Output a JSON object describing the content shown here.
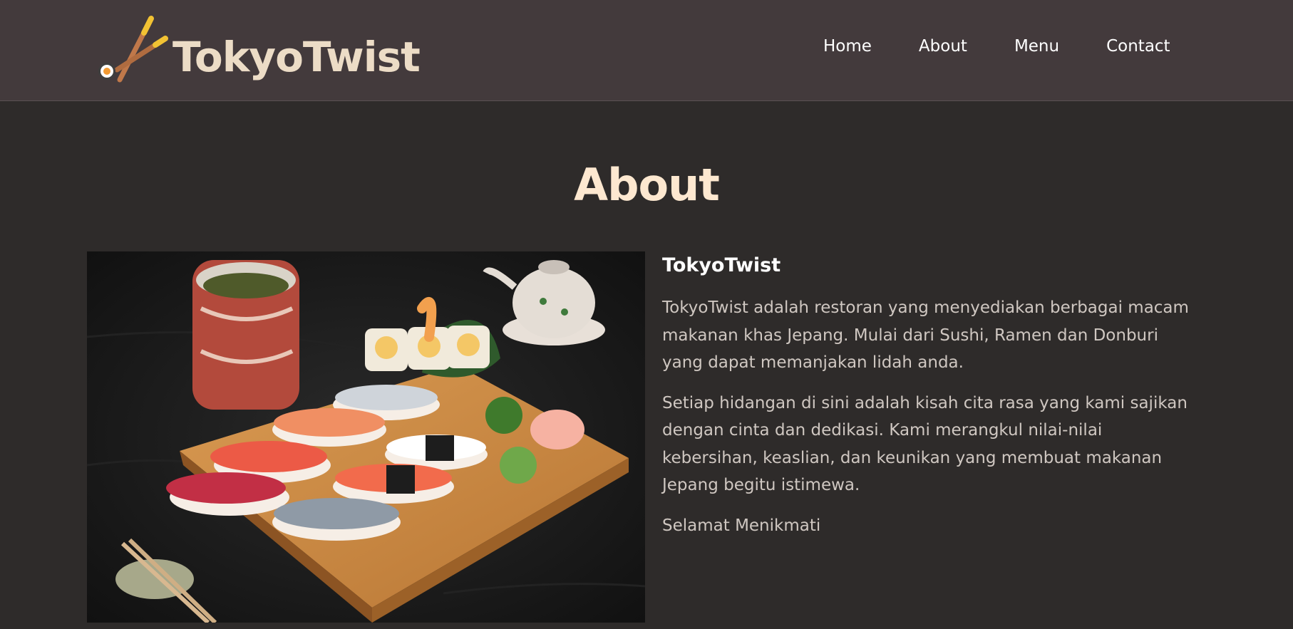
{
  "brand": {
    "name": "TokyoTwist",
    "logo_icon": "chopsticks-sushi-icon"
  },
  "nav": {
    "items": [
      {
        "label": "Home"
      },
      {
        "label": "About"
      },
      {
        "label": "Menu"
      },
      {
        "label": "Contact"
      }
    ]
  },
  "about": {
    "title": "About",
    "image": "sushi-platter-photo",
    "heading": "TokyoTwist",
    "paragraphs": [
      "TokyoTwist adalah restoran yang menyediakan berbagai macam makanan khas Jepang. Mulai dari Sushi, Ramen dan Donburi yang dapat memanjakan lidah anda.",
      "Setiap hidangan di sini adalah kisah cita rasa yang kami sajikan dengan cinta dan dedikasi. Kami merangkul nilai-nilai kebersihan, keaslian, dan keunikan yang membuat makanan Jepang begitu istimewa.",
      "Selamat Menikmati"
    ]
  },
  "colors": {
    "navbar_bg": "#433a3c",
    "page_bg": "#2e2b2a",
    "brand_text": "#ecdcc6",
    "title_text": "#fde8d0",
    "body_text": "#cfc7c1"
  }
}
